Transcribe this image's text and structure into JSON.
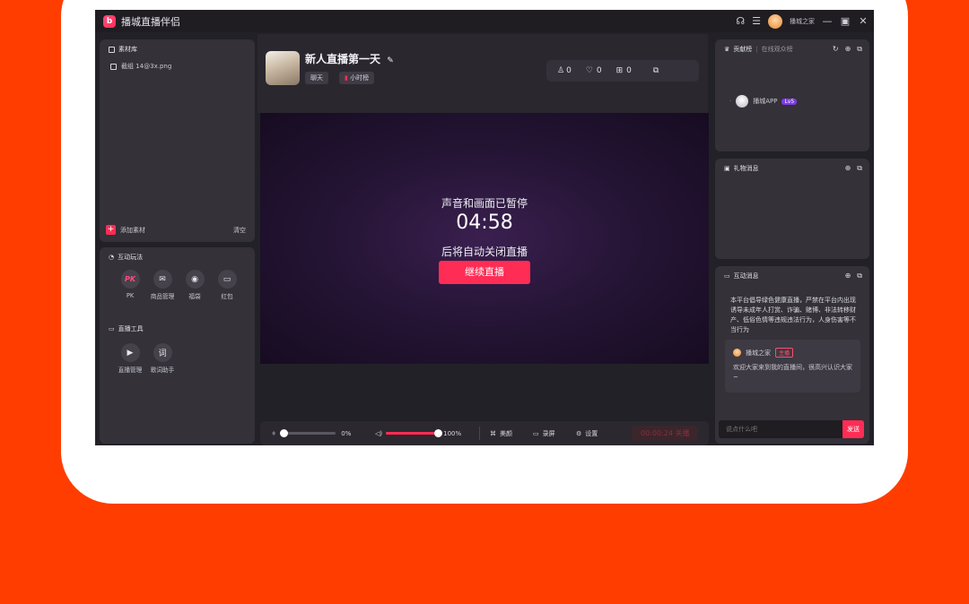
{
  "colors": {
    "background": "#ff3d00",
    "accent": "#ff2d55",
    "window": "#232128"
  },
  "app": {
    "title": "播城直播伴侣",
    "user": "播城之家"
  },
  "titlebar_icons": [
    "headset-icon",
    "menu-icon",
    "minimize-icon",
    "maximize-icon",
    "close-icon"
  ],
  "library": {
    "title": "素材库",
    "item": "截组 14@3x.png",
    "add": "添加素材",
    "clear": "清空"
  },
  "interactive": {
    "title": "互动玩法",
    "tools": [
      {
        "label": "PK",
        "glyph": "PK"
      },
      {
        "label": "商品管理",
        "glyph": "✉"
      },
      {
        "label": "福袋",
        "glyph": "◉"
      },
      {
        "label": "红包",
        "glyph": "▭"
      }
    ]
  },
  "live_tools": {
    "title": "直播工具",
    "tools": [
      {
        "label": "直播管理",
        "glyph": "▶"
      },
      {
        "label": "歌词助手",
        "glyph": "词"
      }
    ]
  },
  "stream": {
    "title": "新人直播第一天",
    "tag1": "聊天",
    "tag2": "小时榜"
  },
  "stats": {
    "viewers": "0",
    "likes": "0",
    "gifts": "0"
  },
  "video": {
    "paused_text": "声音和画面已暂停",
    "countdown": "04:58",
    "auto_close_text": "后将自动关闭直播",
    "resume_button": "继续直播"
  },
  "bottom": {
    "mic_percent": "0%",
    "mic_level": 0,
    "volume_percent": "100%",
    "volume_level": 100,
    "beauty": "美颜",
    "record": "录屏",
    "settings": "设置",
    "timer": "00:00:24 关播"
  },
  "ranking": {
    "title": "贡献榜",
    "subtitle": "在线观众榜",
    "user": "播城APP",
    "level": "Lv5"
  },
  "gift": {
    "title": "礼物消息"
  },
  "chat": {
    "title": "互动消息",
    "notice": "本平台倡导绿色健康直播，严禁在平台内出现诱导未成年人打赏、诈骗、赌博、非法转移财产、低俗色情等违规违法行为，人身伤害等不当行为",
    "msg_user": "播城之家",
    "msg_role": "主播",
    "msg_text": "欢迎大家来到我的直播间，很高兴认识大家~",
    "input_placeholder": "说点什么吧",
    "send": "发送"
  }
}
